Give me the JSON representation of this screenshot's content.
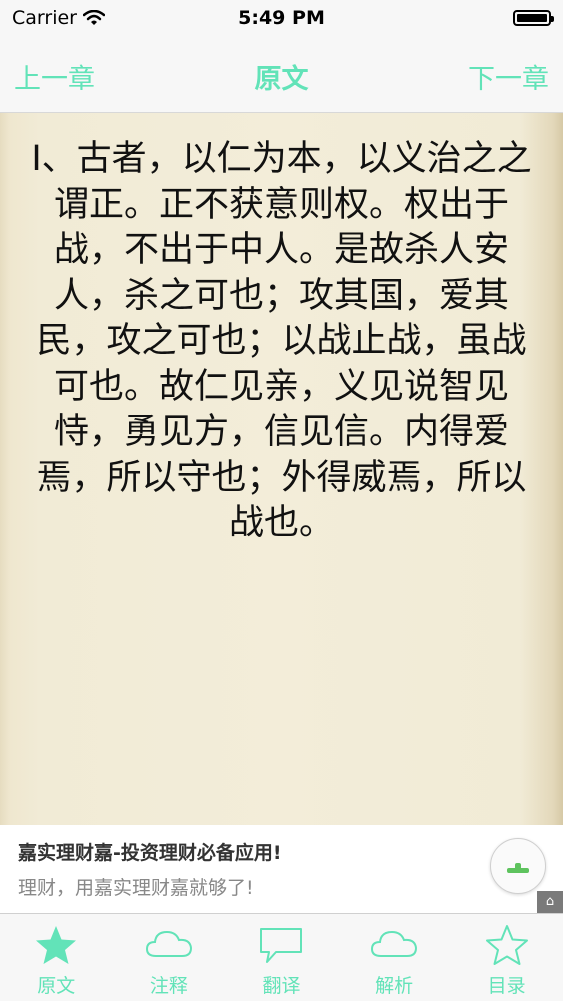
{
  "status_bar": {
    "carrier": "Carrier",
    "time": "5:49 PM"
  },
  "nav": {
    "prev_label": "上一章",
    "title": "原文",
    "next_label": "下一章"
  },
  "content": {
    "text": "I、古者，以仁为本，以义治之之谓正。正不获意则权。权出于战，不出于中人。是故杀人安人，杀之可也；攻其国，爱其民，攻之可也；以战止战，虽战可也。故仁见亲，义见说智见恃，勇见方，信见信。内得爱焉，所以守也；外得威焉，所以战也。"
  },
  "ad": {
    "title": "嘉实理财嘉-投资理财必备应用!",
    "subtitle": "理财，用嘉实理财嘉就够了!"
  },
  "tabs": [
    {
      "label": "原文",
      "icon": "star-filled-icon"
    },
    {
      "label": "注释",
      "icon": "cloud-icon"
    },
    {
      "label": "翻译",
      "icon": "speech-bubble-icon"
    },
    {
      "label": "解析",
      "icon": "cloud-icon"
    },
    {
      "label": "目录",
      "icon": "star-outline-icon"
    }
  ],
  "colors": {
    "accent": "#62e3b8",
    "paper": "#f3edd9",
    "text": "#111111"
  }
}
